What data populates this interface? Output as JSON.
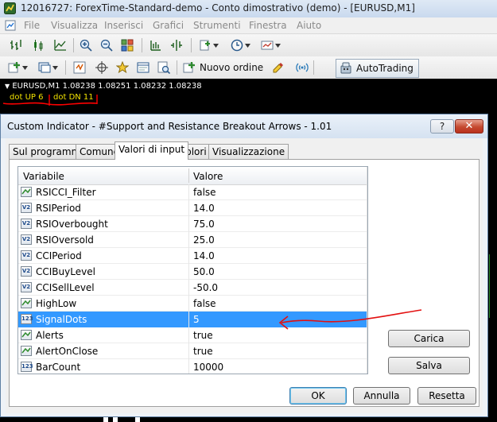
{
  "window": {
    "title": "12016727: ForexTime-Standard-demo - Conto dimostrativo (demo) - [EURUSD,M1]"
  },
  "menu": {
    "items": [
      "File",
      "Visualizza",
      "Inserisci",
      "Grafici",
      "Strumenti",
      "Finestra",
      "Aiuto"
    ]
  },
  "toolbar": {
    "new_order_label": "Nuovo ordine",
    "autotrading_label": "AutoTrading"
  },
  "chart": {
    "header": "EURUSD,M1  1.08238 1.08251 1.08232 1.08238",
    "labels": {
      "dot_up": "dot  UP  6",
      "dot_dn": "dot DN  11"
    },
    "annotation_color": "#ff0000",
    "label_color": "#f2e200"
  },
  "dialog": {
    "title": "Custom Indicator - #Support and Resistance Breakout Arrows - 1.01",
    "help_label": "?",
    "close_label": "✕",
    "tabs": [
      {
        "label": "Sul programma",
        "active": false
      },
      {
        "label": "Comune",
        "active": false
      },
      {
        "label": "Valori di input",
        "active": true
      },
      {
        "label": "Colori",
        "active": false
      },
      {
        "label": "Visualizzazione",
        "active": false
      }
    ],
    "table": {
      "columns": [
        "Variabile",
        "Valore"
      ],
      "rows": [
        {
          "icon": "bool-icon",
          "name": "RSICCI_Filter",
          "value": "false",
          "selected": false
        },
        {
          "icon": "value-icon",
          "name": "RSIPeriod",
          "value": "14.0",
          "selected": false
        },
        {
          "icon": "value-icon",
          "name": "RSIOverbought",
          "value": "75.0",
          "selected": false
        },
        {
          "icon": "value-icon",
          "name": "RSIOversold",
          "value": "25.0",
          "selected": false
        },
        {
          "icon": "value-icon",
          "name": "CCIPeriod",
          "value": "14.0",
          "selected": false
        },
        {
          "icon": "value-icon",
          "name": "CCIBuyLevel",
          "value": "50.0",
          "selected": false
        },
        {
          "icon": "value-icon",
          "name": "CCISellLevel",
          "value": "-50.0",
          "selected": false
        },
        {
          "icon": "bool-icon",
          "name": "HighLow",
          "value": "false",
          "selected": false
        },
        {
          "icon": "int-icon",
          "name": "SignalDots",
          "value": "5",
          "selected": true
        },
        {
          "icon": "bool-icon",
          "name": "Alerts",
          "value": "true",
          "selected": false
        },
        {
          "icon": "bool-icon",
          "name": "AlertOnClose",
          "value": "true",
          "selected": false
        },
        {
          "icon": "int-icon",
          "name": "BarCount",
          "value": "10000",
          "selected": false
        }
      ],
      "icon_text": {
        "value-icon": "V2",
        "int-icon": "123",
        "bool-icon": ""
      }
    },
    "buttons": {
      "load": "Carica",
      "save": "Salva",
      "ok": "OK",
      "cancel": "Annulla",
      "reset": "Resetta"
    },
    "selection_color": "#3399ff"
  }
}
